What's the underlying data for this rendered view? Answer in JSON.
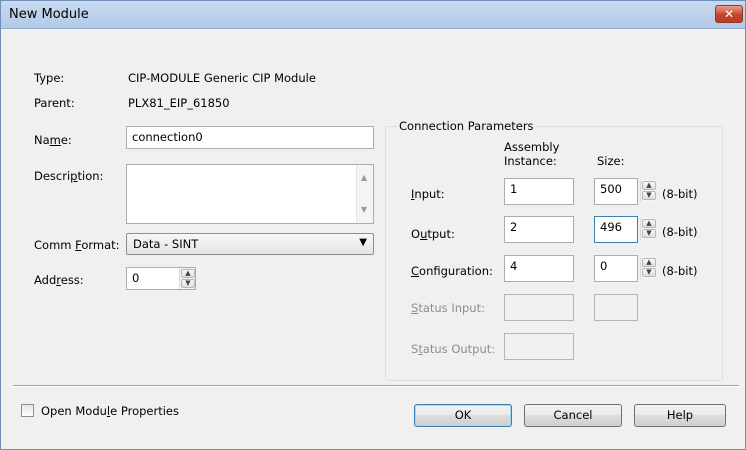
{
  "window": {
    "title": "New Module",
    "close_glyph": "✕"
  },
  "type": {
    "label": "Type:",
    "value": "CIP-MODULE Generic CIP Module"
  },
  "parent": {
    "label": "Parent:",
    "value": "PLX81_EIP_61850"
  },
  "name": {
    "label_pre": "Na",
    "label_u": "m",
    "label_post": "e:",
    "value": "connection0"
  },
  "description": {
    "label_pre": "Descri",
    "label_u": "p",
    "label_post": "tion:",
    "value": ""
  },
  "comm_format": {
    "label_pre": "Comm ",
    "label_u": "F",
    "label_post": "ormat:",
    "value": "Data - SINT"
  },
  "address": {
    "label_pre": "Add",
    "label_u": "r",
    "label_post": "ess:",
    "value": "0"
  },
  "connection": {
    "legend": "Connection Parameters",
    "col_assembly_line1": "Assembly",
    "col_assembly_line2": "Instance:",
    "col_size": "Size:",
    "unit": "(8-bit)",
    "input": {
      "label_u": "I",
      "label_post": "nput:",
      "instance": "1",
      "size": "500"
    },
    "output": {
      "label_pre": "O",
      "label_u": "u",
      "label_post": "tput:",
      "instance": "2",
      "size": "496"
    },
    "configuration": {
      "label_u": "C",
      "label_post": "onfiguration:",
      "instance": "4",
      "size": "0"
    },
    "status_input": {
      "label_u": "S",
      "label_post": "tatus Input:"
    },
    "status_output": {
      "label_pre": "S",
      "label_u": "t",
      "label_post": "atus Output:"
    }
  },
  "footer": {
    "open_props_pre": "Open Modu",
    "open_props_u": "l",
    "open_props_post": "e Properties",
    "open_props_checked": false,
    "ok": "OK",
    "cancel": "Cancel",
    "help": "Help"
  },
  "icons": {
    "spin_up": "▲",
    "spin_down": "▼",
    "dropdown": "▼"
  },
  "colors": {
    "titlebar": "#b9cde8",
    "close_button": "#c7442b",
    "dialog_bg": "#f0f0f0"
  }
}
